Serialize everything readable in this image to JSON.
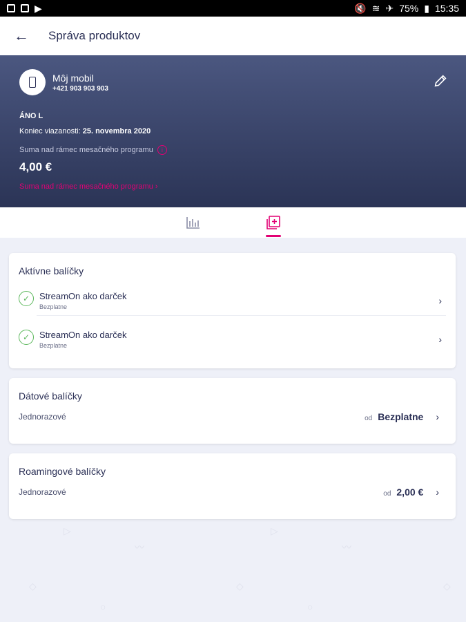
{
  "status_bar": {
    "battery": "75%",
    "time": "15:35"
  },
  "header": {
    "title": "Správa produktov"
  },
  "banner": {
    "device_name": "Môj mobil",
    "device_number": "+421 903 903 903",
    "plan": "ÁNO L",
    "commitment_label": "Koniec viazanosti:",
    "commitment_date": "25. novembra 2020",
    "overlimit_label": "Suma nad rámec mesačného programu",
    "overlimit_amount": "4,00 €",
    "overlimit_link": "Suma nad rámec mesačného programu"
  },
  "cards": {
    "active": {
      "title": "Aktívne balíčky",
      "items": [
        {
          "name": "StreamOn ako darček",
          "sub": "Bezplatne"
        },
        {
          "name": "StreamOn ako darček",
          "sub": "Bezplatne"
        }
      ]
    },
    "data": {
      "title": "Dátové balíčky",
      "row_label": "Jednorazové",
      "od": "od",
      "price": "Bezplatne"
    },
    "roaming": {
      "title": "Roamingové balíčky",
      "row_label": "Jednorazové",
      "od": "od",
      "price": "2,00 €"
    }
  },
  "colors": {
    "accent": "#e20074",
    "banner_top": "#4b5780",
    "banner_bottom": "#2b3456",
    "success": "#5cb85c"
  }
}
